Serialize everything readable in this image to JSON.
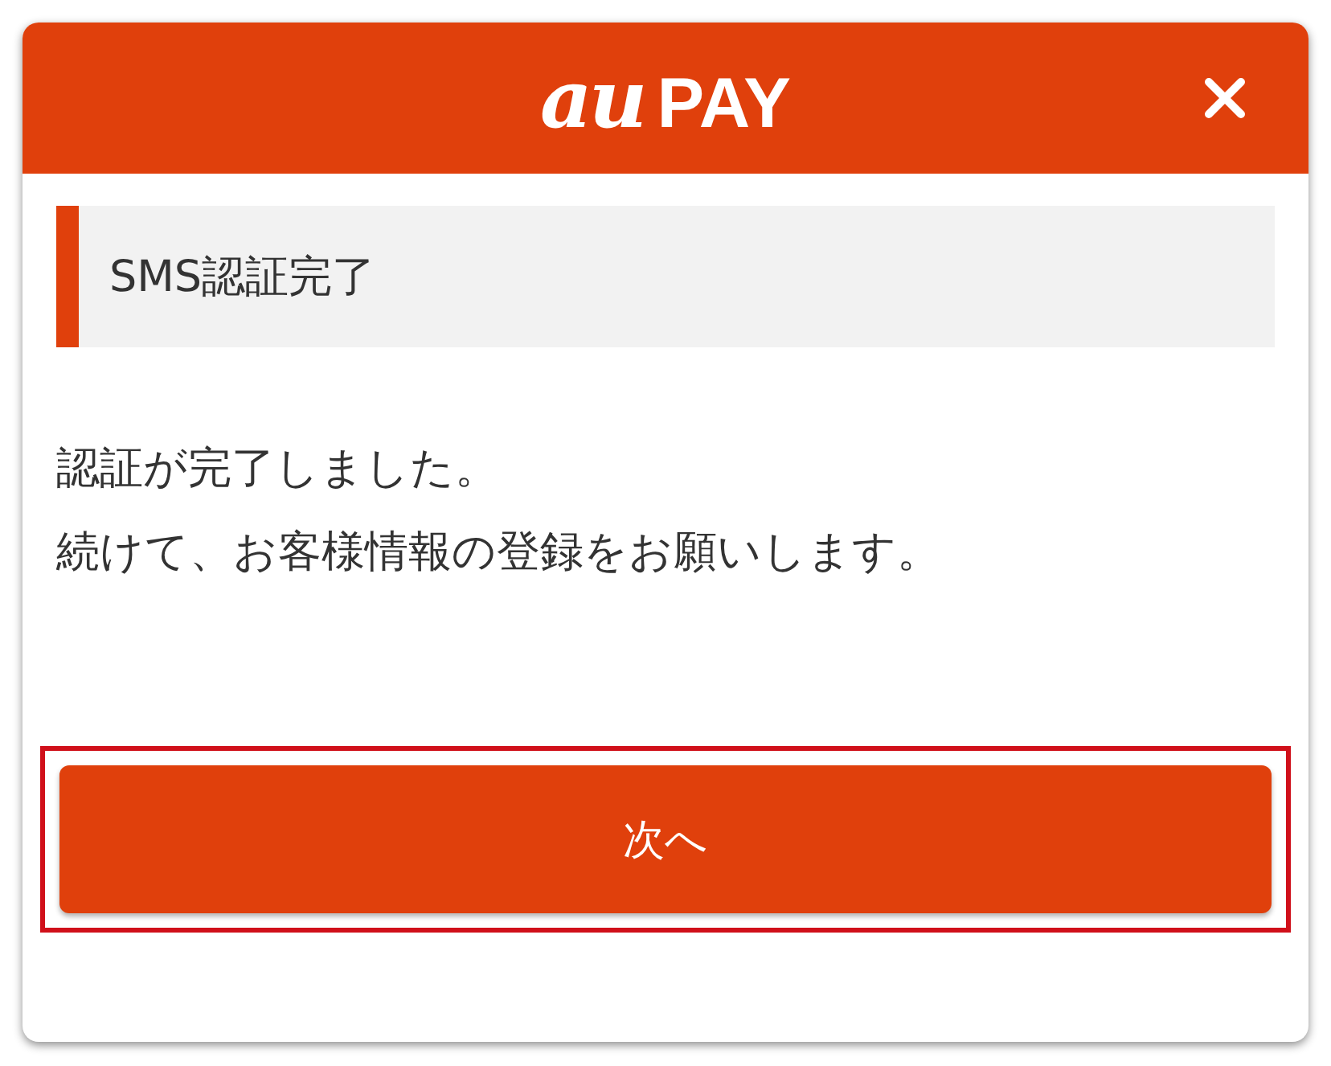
{
  "header": {
    "logo_au": "au",
    "logo_pay": "PAY"
  },
  "heading": "SMS認証完了",
  "message": [
    "認証が完了しました。",
    "続けて、お客様情報の登録をお願いします。"
  ],
  "button": {
    "label": "次へ",
    "highlighted": true
  }
}
